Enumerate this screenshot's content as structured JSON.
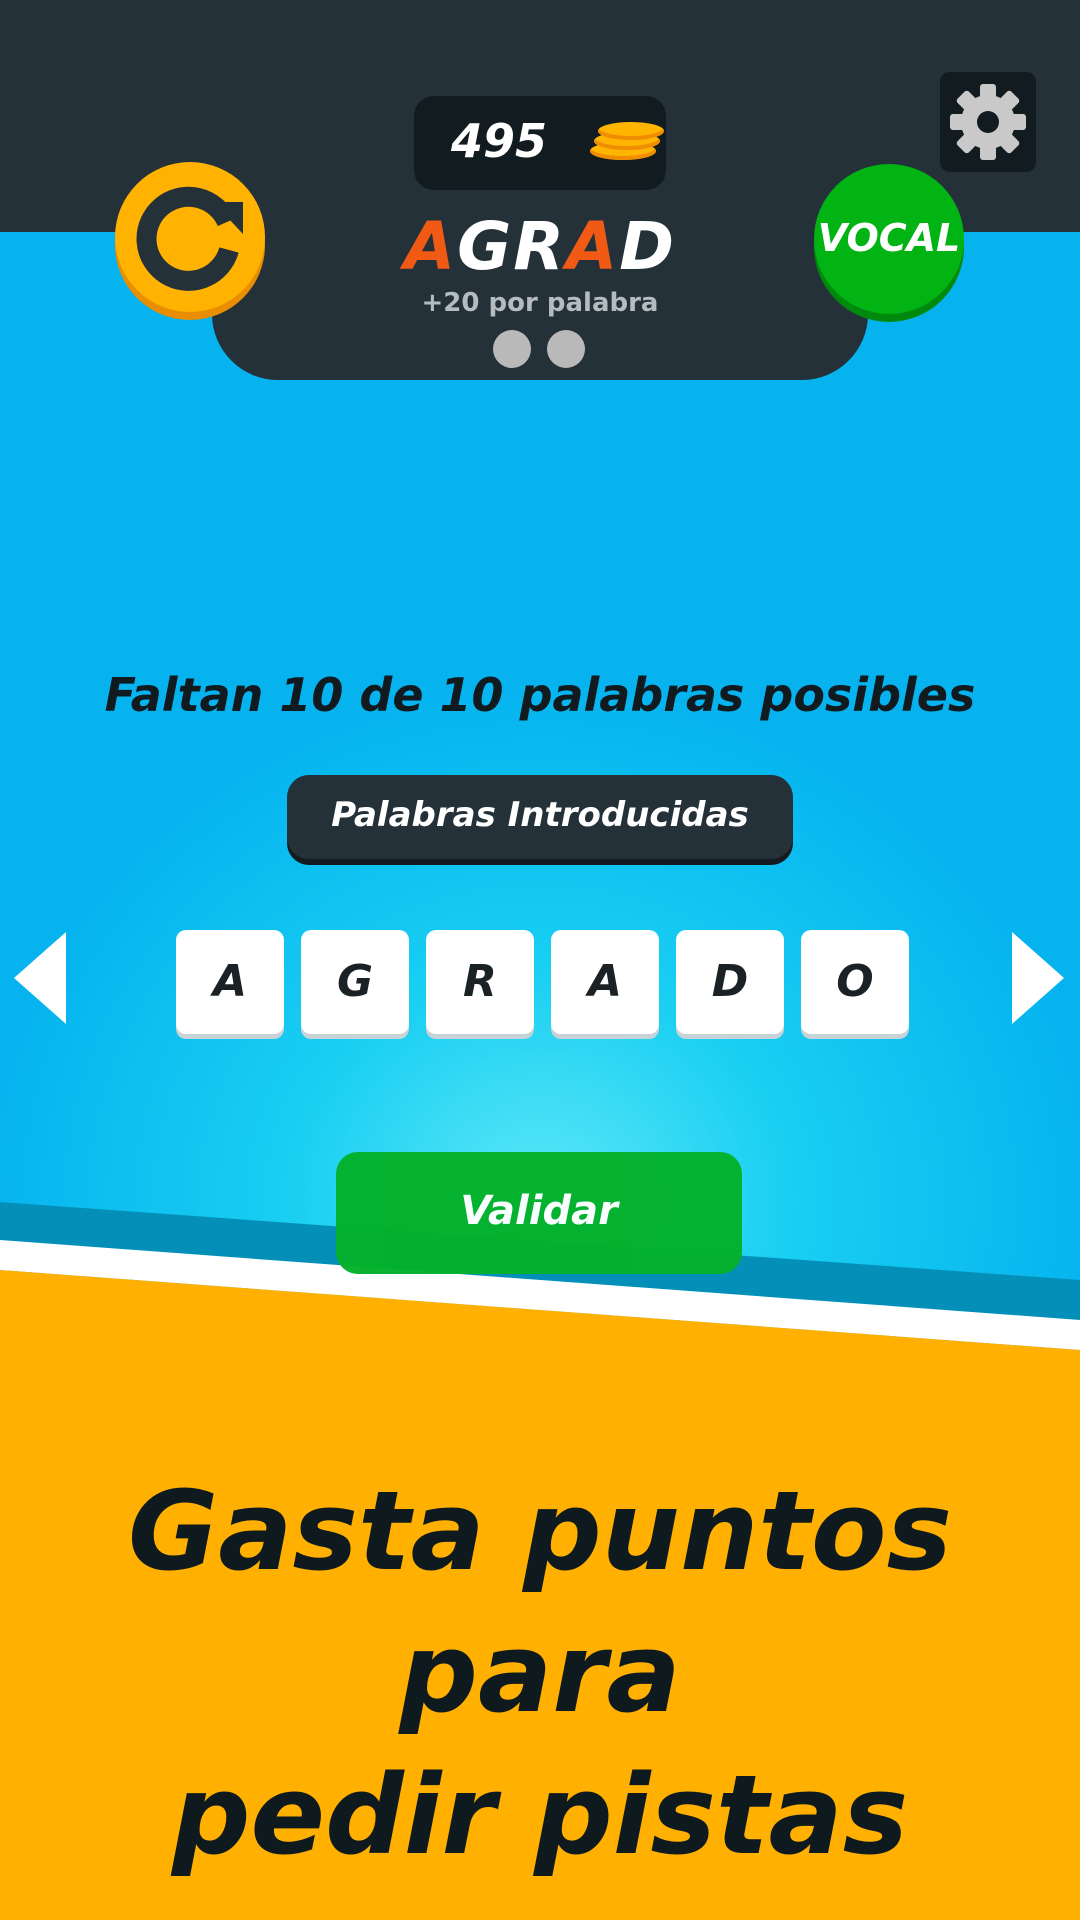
{
  "header": {
    "coins": "495",
    "word_letters": [
      {
        "char": "A",
        "vowel": true
      },
      {
        "char": "G",
        "vowel": false
      },
      {
        "char": "R",
        "vowel": false
      },
      {
        "char": "A",
        "vowel": true
      },
      {
        "char": "D",
        "vowel": false
      }
    ],
    "reward_text": "+20 por palabra",
    "vocal_label": "VOCAL"
  },
  "main": {
    "missing_text": "Faltan 10 de 10 palabras posibles",
    "entered_words_label": "Palabras Introducidas",
    "tiles": [
      "A",
      "G",
      "R",
      "A",
      "D",
      "O"
    ],
    "validate_label": "Validar"
  },
  "promo": {
    "line1": "Gasta puntos para",
    "line2": "pedir pistas"
  },
  "colors": {
    "accent_orange": "#f05a14",
    "coin_yellow": "#ffb400",
    "vocal_green": "#02b314",
    "validate_green": "#03b12a",
    "dark_panel": "#253139",
    "promo_bg": "#ffb000",
    "sky_blue": "#06b3ef"
  },
  "icons": {
    "refresh": "refresh-icon",
    "settings": "gear-icon",
    "coin": "coin-stack-icon",
    "prev": "arrow-left-icon",
    "next": "arrow-right-icon"
  }
}
